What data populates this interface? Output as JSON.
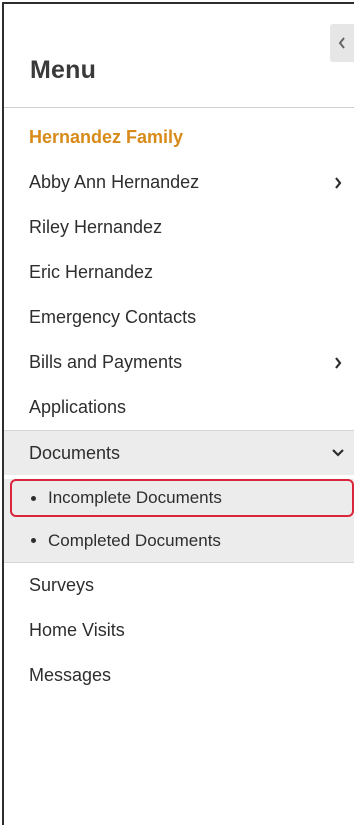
{
  "menu": {
    "title": "Menu",
    "family_name": "Hernandez Family",
    "items": [
      {
        "label": "Abby Ann Hernandez",
        "has_chevron": true
      },
      {
        "label": "Riley Hernandez",
        "has_chevron": false
      },
      {
        "label": "Eric Hernandez",
        "has_chevron": false
      },
      {
        "label": "Emergency Contacts",
        "has_chevron": false
      },
      {
        "label": "Bills and Payments",
        "has_chevron": true
      },
      {
        "label": "Applications",
        "has_chevron": false
      }
    ],
    "documents": {
      "label": "Documents",
      "expanded": true,
      "sub_items": [
        {
          "label": "Incomplete Documents",
          "highlighted": true
        },
        {
          "label": "Completed Documents",
          "highlighted": false
        }
      ]
    },
    "bottom_items": [
      {
        "label": "Surveys"
      },
      {
        "label": "Home Visits"
      },
      {
        "label": "Messages"
      }
    ]
  },
  "colors": {
    "family_accent": "#d88b1a",
    "highlight_border": "#d9263a",
    "expanded_bg": "#ececec",
    "text": "#2e2e2e"
  },
  "icons": {
    "collapse": "chevron-left-icon",
    "expand": "chevron-right-icon",
    "expanded": "chevron-down-icon",
    "bullet": "bullet-icon"
  }
}
